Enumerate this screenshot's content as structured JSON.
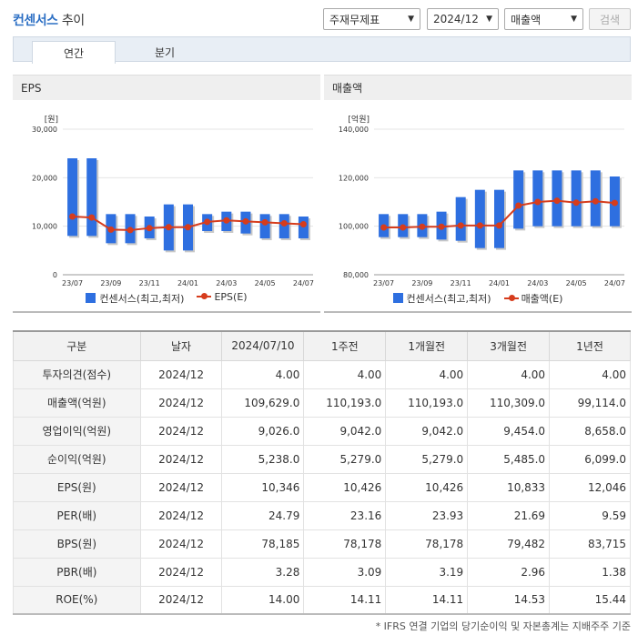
{
  "header": {
    "title_main": "컨센서스",
    "title_sub": "추이",
    "select_type": "주재무제표",
    "select_date": "2024/12",
    "select_metric": "매출액",
    "search_label": "검색"
  },
  "tabs": [
    {
      "label": "연간"
    },
    {
      "label": "분기"
    }
  ],
  "charts": {
    "eps": {
      "title": "EPS",
      "unit": "[원]",
      "legend_bar": "컨센서스(최고,최저)",
      "legend_line": "EPS(E)"
    },
    "rev": {
      "title": "매출액",
      "unit": "[억원]",
      "legend_bar": "컨센서스(최고,최저)",
      "legend_line": "매출액(E)"
    }
  },
  "chart_data": [
    {
      "type": "bar",
      "title": "EPS",
      "ylabel": "[원]",
      "ylim": [
        0,
        30000
      ],
      "yticks": [
        "0",
        "10,000",
        "20,000",
        "30,000"
      ],
      "xticks": [
        "23/07",
        "23/09",
        "23/11",
        "24/01",
        "24/03",
        "24/05",
        "24/07"
      ],
      "categories": [
        "23/07",
        "23/08",
        "23/09",
        "23/10",
        "23/11",
        "23/12",
        "24/01",
        "24/02",
        "24/03",
        "24/04",
        "24/05",
        "24/06",
        "24/07"
      ],
      "series": [
        {
          "name": "컨센서스(최고,최저)",
          "kind": "range",
          "low": [
            8000,
            8000,
            6500,
            6500,
            7500,
            5000,
            5000,
            9000,
            9000,
            8500,
            7500,
            7500,
            7500
          ],
          "high": [
            24000,
            24000,
            12500,
            12500,
            12000,
            14500,
            14500,
            12500,
            13000,
            13000,
            12500,
            12500,
            12000
          ]
        },
        {
          "name": "EPS(E)",
          "kind": "line",
          "values": [
            12000,
            11800,
            9300,
            9200,
            9600,
            9800,
            9800,
            10900,
            11200,
            11000,
            10800,
            10600,
            10400
          ]
        }
      ],
      "grid": true,
      "legend": "bottom"
    },
    {
      "type": "bar",
      "title": "매출액",
      "ylabel": "[억원]",
      "ylim": [
        80000,
        140000
      ],
      "yticks": [
        "80,000",
        "100,000",
        "120,000",
        "140,000"
      ],
      "xticks": [
        "23/07",
        "23/09",
        "23/11",
        "24/01",
        "24/03",
        "24/05",
        "24/07"
      ],
      "categories": [
        "23/07",
        "23/08",
        "23/09",
        "23/10",
        "23/11",
        "23/12",
        "24/01",
        "24/02",
        "24/03",
        "24/04",
        "24/05",
        "24/06",
        "24/07"
      ],
      "series": [
        {
          "name": "컨센서스(최고,최저)",
          "kind": "range",
          "low": [
            95500,
            95500,
            95500,
            94500,
            94000,
            91000,
            91000,
            99000,
            100000,
            100000,
            100000,
            100000,
            100000
          ],
          "high": [
            105000,
            105000,
            105000,
            106000,
            112000,
            115000,
            115000,
            123000,
            123000,
            123000,
            123000,
            123000,
            120500
          ]
        },
        {
          "name": "매출액(E)",
          "kind": "line",
          "values": [
            99500,
            99500,
            99800,
            99800,
            100300,
            100300,
            100300,
            108500,
            110000,
            110500,
            109700,
            110300,
            109600
          ]
        }
      ],
      "grid": true,
      "legend": "bottom"
    }
  ],
  "table": {
    "headers": [
      "구분",
      "날자",
      "2024/07/10",
      "1주전",
      "1개월전",
      "3개월전",
      "1년전"
    ],
    "rows": [
      [
        "투자의견(점수)",
        "2024/12",
        "4.00",
        "4.00",
        "4.00",
        "4.00",
        "4.00"
      ],
      [
        "매출액(억원)",
        "2024/12",
        "109,629.0",
        "110,193.0",
        "110,193.0",
        "110,309.0",
        "99,114.0"
      ],
      [
        "영업이익(억원)",
        "2024/12",
        "9,026.0",
        "9,042.0",
        "9,042.0",
        "9,454.0",
        "8,658.0"
      ],
      [
        "순이익(억원)",
        "2024/12",
        "5,238.0",
        "5,279.0",
        "5,279.0",
        "5,485.0",
        "6,099.0"
      ],
      [
        "EPS(원)",
        "2024/12",
        "10,346",
        "10,426",
        "10,426",
        "10,833",
        "12,046"
      ],
      [
        "PER(배)",
        "2024/12",
        "24.79",
        "23.16",
        "23.93",
        "21.69",
        "9.59"
      ],
      [
        "BPS(원)",
        "2024/12",
        "78,185",
        "78,178",
        "78,178",
        "79,482",
        "83,715"
      ],
      [
        "PBR(배)",
        "2024/12",
        "3.28",
        "3.09",
        "3.19",
        "2.96",
        "1.38"
      ],
      [
        "ROE(%)",
        "2024/12",
        "14.00",
        "14.11",
        "14.11",
        "14.53",
        "15.44"
      ]
    ]
  },
  "footnote": "* IFRS 연결 기업의 당기순이익 및 자본총계는 지배주주 기준",
  "colors": {
    "bar": "#2e6fe0",
    "line": "#d63c1c",
    "accent": "#2c6fc4"
  }
}
